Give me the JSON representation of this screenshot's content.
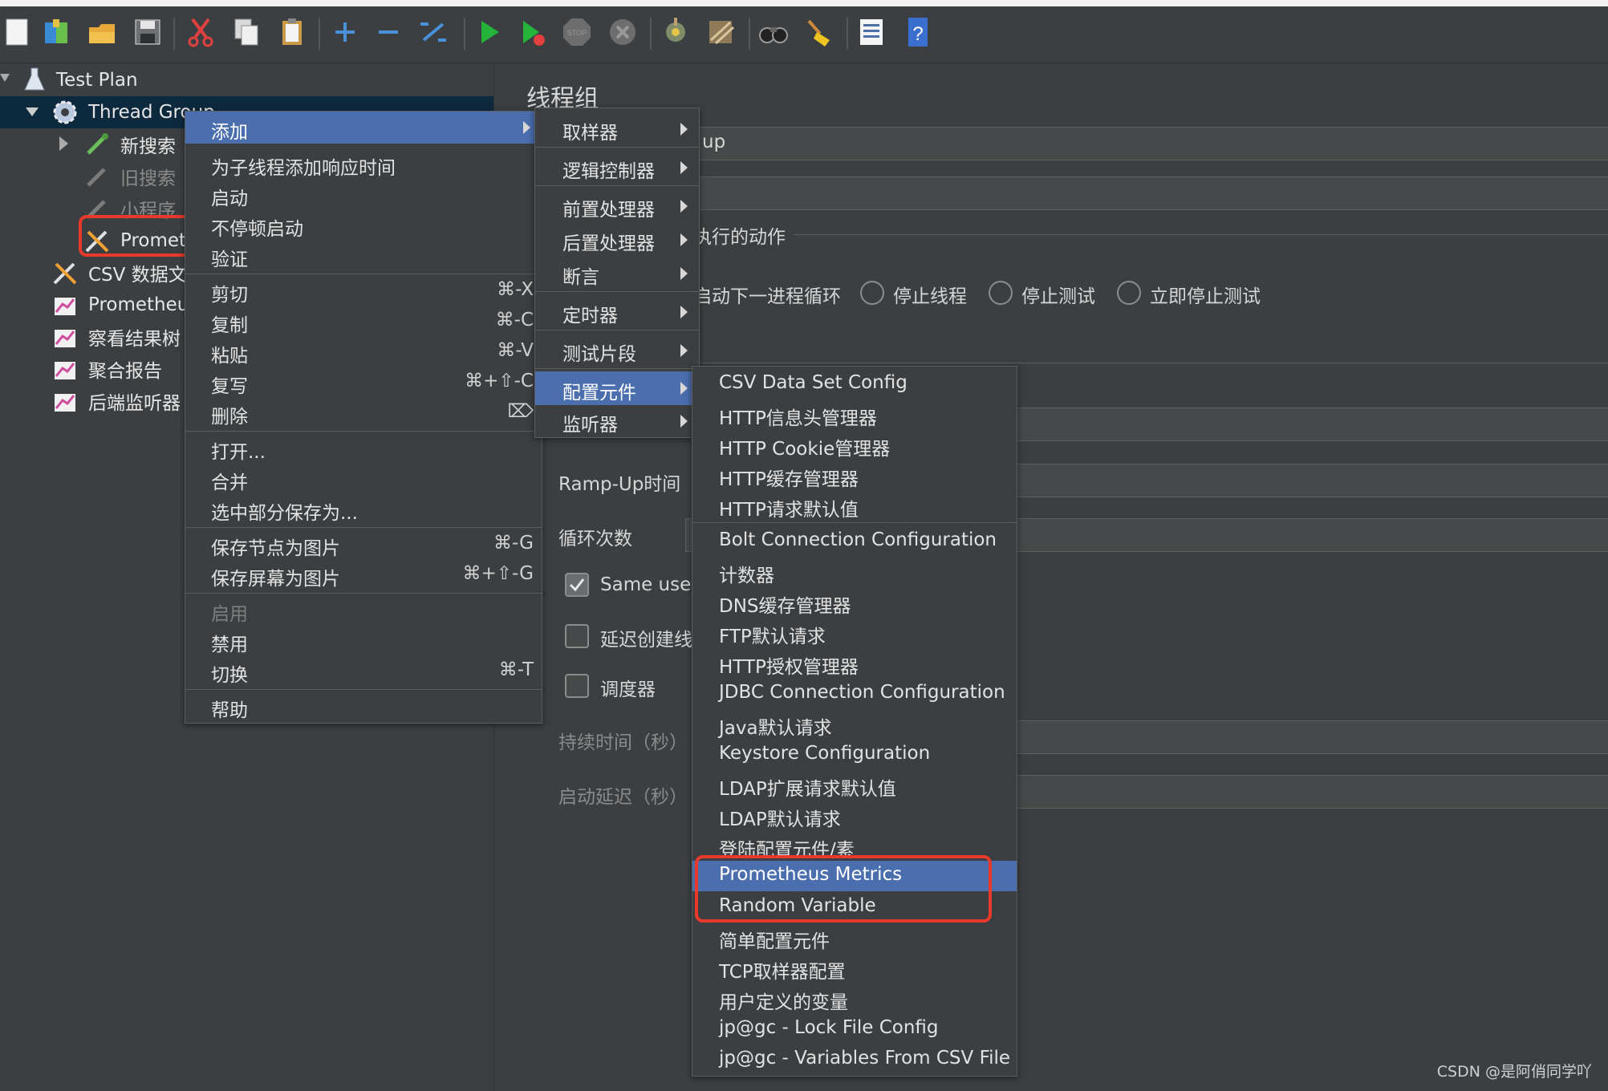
{
  "toolbar": {
    "icons": [
      "new-icon",
      "templates-icon",
      "open-icon",
      "save-icon",
      "cut-icon",
      "copy-icon",
      "paste-icon",
      "expand-icon",
      "collapse-icon",
      "toggle-icon",
      "start-icon",
      "start-no-pause-icon",
      "stop-icon",
      "shutdown-icon",
      "clear-icon",
      "clear-all-icon",
      "search-icon",
      "reset-search-icon",
      "function-helper-icon",
      "help-icon"
    ]
  },
  "tree": {
    "items": [
      {
        "label": "Test Plan"
      },
      {
        "label": "Thread Group"
      },
      {
        "label": "新搜索"
      },
      {
        "label": "旧搜索"
      },
      {
        "label": "小程序"
      },
      {
        "label": "Promet"
      },
      {
        "label": "CSV 数据文"
      },
      {
        "label": "Prometheu"
      },
      {
        "label": "察看结果树"
      },
      {
        "label": "聚合报告"
      },
      {
        "label": "后端监听器"
      }
    ]
  },
  "panel": {
    "title": "线程组",
    "name_value_partial": "up",
    "action_label_partial": "执行的动作",
    "radio_options": [
      "启动下一进程循环",
      "停止线程",
      "停止测试",
      "立即停止测试"
    ],
    "rampup_label": "Ramp-Up时间（",
    "loop_label": "循环次数",
    "same_user_label": "Same user",
    "delay_label": "延迟创建线",
    "scheduler_label": "调度器",
    "duration_label": "持续时间（秒）",
    "startup_delay_label": "启动延迟（秒）"
  },
  "context_menu": {
    "items": [
      {
        "label": "添加"
      },
      {
        "label": "为子线程添加响应时间"
      },
      {
        "label": "启动"
      },
      {
        "label": "不停顿启动"
      },
      {
        "label": "验证"
      },
      {
        "label": "剪切",
        "shortcut": "⌘-X"
      },
      {
        "label": "复制",
        "shortcut": "⌘-C"
      },
      {
        "label": "粘贴",
        "shortcut": "⌘-V"
      },
      {
        "label": "复写",
        "shortcut": "⌘+⇧-C"
      },
      {
        "label": "删除",
        "shortcut": "⌦"
      },
      {
        "label": "打开..."
      },
      {
        "label": "合并"
      },
      {
        "label": "选中部分保存为..."
      },
      {
        "label": "保存节点为图片",
        "shortcut": "⌘-G"
      },
      {
        "label": "保存屏幕为图片",
        "shortcut": "⌘+⇧-G"
      },
      {
        "label": "启用"
      },
      {
        "label": "禁用"
      },
      {
        "label": "切换",
        "shortcut": "⌘-T"
      },
      {
        "label": "帮助"
      }
    ]
  },
  "add_submenu": {
    "items": [
      {
        "label": "取样器"
      },
      {
        "label": "逻辑控制器"
      },
      {
        "label": "前置处理器"
      },
      {
        "label": "后置处理器"
      },
      {
        "label": "断言"
      },
      {
        "label": "定时器"
      },
      {
        "label": "测试片段"
      },
      {
        "label": "配置元件"
      },
      {
        "label": "监听器"
      }
    ]
  },
  "config_submenu": {
    "items": [
      {
        "label": "CSV Data Set Config"
      },
      {
        "label": "HTTP信息头管理器"
      },
      {
        "label": "HTTP Cookie管理器"
      },
      {
        "label": "HTTP缓存管理器"
      },
      {
        "label": "HTTP请求默认值"
      },
      {
        "label": "Bolt Connection Configuration"
      },
      {
        "label": "计数器"
      },
      {
        "label": "DNS缓存管理器"
      },
      {
        "label": "FTP默认请求"
      },
      {
        "label": "HTTP授权管理器"
      },
      {
        "label": "JDBC Connection Configuration"
      },
      {
        "label": "Java默认请求"
      },
      {
        "label": "Keystore Configuration"
      },
      {
        "label": "LDAP扩展请求默认值"
      },
      {
        "label": "LDAP默认请求"
      },
      {
        "label": "登陆配置元件/素"
      },
      {
        "label": "Prometheus Metrics"
      },
      {
        "label": "Random Variable"
      },
      {
        "label": "简单配置元件"
      },
      {
        "label": "TCP取样器配置"
      },
      {
        "label": "用户定义的变量"
      },
      {
        "label": "jp@gc - Lock File Config"
      },
      {
        "label": "jp@gc - Variables From CSV File"
      }
    ]
  },
  "watermark": "CSDN @是阿俏同学吖",
  "colors": {
    "background": "#3c3f41",
    "highlight": "#4b6eaf",
    "annotation_red": "#e8392b",
    "tree_selection": "#0d293e"
  }
}
